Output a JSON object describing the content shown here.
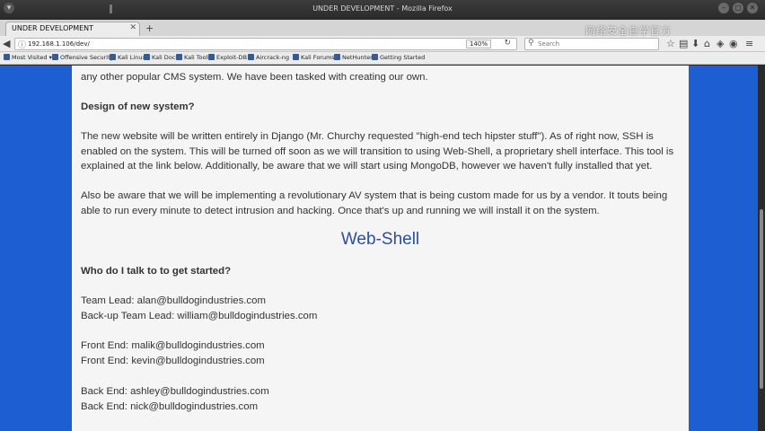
{
  "window": {
    "title": "UNDER DEVELOPMENT - Mozilla Firefox",
    "icons": [
      "menu-icon",
      "close-icon",
      "minimize-icon",
      "maximize-icon",
      "close-window-icon"
    ]
  },
  "tabs": [
    {
      "label": "UNDER DEVELOPMENT"
    }
  ],
  "nav": {
    "url": "192.168.1.106/dev/",
    "zoom": "140%",
    "search_placeholder": "Search"
  },
  "bookmarks": [
    "Most Visited ▾",
    "Offensive Security",
    "Kali Linux",
    "Kali Docs",
    "Kali Tools",
    "Exploit-DB",
    "Aircrack-ng",
    "Kali Forums",
    "NetHunter",
    "Getting Started"
  ],
  "watermark": "网络安全自学官方",
  "content": {
    "intro_tail": "any other popular CMS system. We have been tasked with creating our own.",
    "design_heading": "Design of new system?",
    "design_text": "The new website will be written entirely in Django (Mr. Churchy requested \"high-end tech hipster stuff\"). As of right now, SSH is enabled on the system. This will be turned off soon as we will transition to using Web-Shell, a proprietary shell interface. This tool is explained at the link below. Additionally, be aware that we will start using MongoDB, however we haven't fully installed that yet.",
    "av_text": "Also be aware that we will be implementing a revolutionary AV system that is being custom made for us by a vendor. It touts being able to run every minute to detect intrusion and hacking. Once that's up and running we will install it on the system.",
    "webshell_link": "Web-Shell",
    "contact_heading": "Who do I talk to to get started?",
    "contacts": [
      "Team Lead: alan@bulldogindustries.com",
      "Back-up Team Lead: william@bulldogindustries.com",
      "Front End: malik@bulldogindustries.com",
      "Front End: kevin@bulldogindustries.com",
      "Back End: ashley@bulldogindustries.com",
      "Back End: nick@bulldogindustries.com"
    ]
  }
}
